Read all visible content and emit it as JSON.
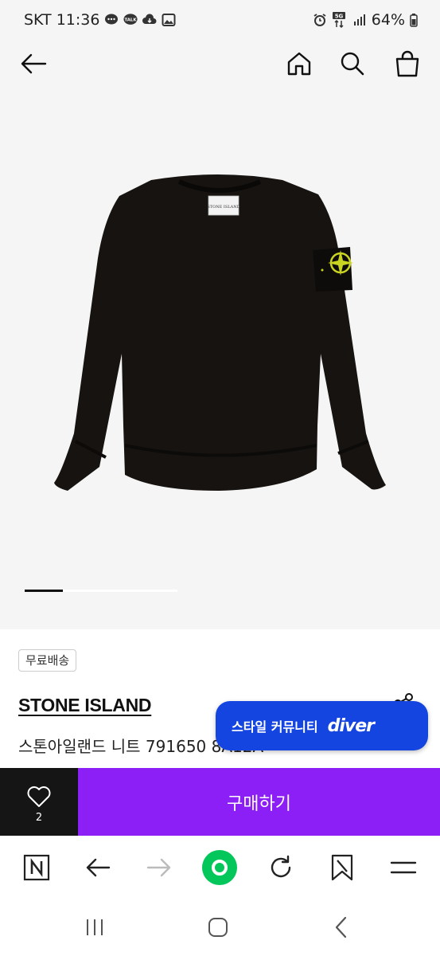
{
  "status_bar": {
    "carrier_time": "SKT 11:36",
    "talk_icon_label": "TALK",
    "network": "5G",
    "battery": "64%",
    "icons": [
      "chat-bubble-icon",
      "talk-icon",
      "cloud-download-icon",
      "gallery-icon",
      "alarm-icon",
      "network-arrows-icon",
      "signal-icon",
      "battery-icon"
    ]
  },
  "app_bar": {
    "icons": [
      "back-arrow-icon",
      "home-icon",
      "search-icon",
      "shopping-bag-icon"
    ]
  },
  "gallery": {
    "image_label": "STONE ISLAND",
    "progress": 0.25
  },
  "product": {
    "badge": "무료배송",
    "brand": "STONE ISLAND",
    "title": "스톤아일랜드 니트 791650 8A12A"
  },
  "diver_banner": {
    "text": "스타일 커뮤니티",
    "logo": "diver"
  },
  "actions": {
    "wish_count": "2",
    "buy_label": "구매하기"
  },
  "colors": {
    "buy": "#8c1ff5",
    "banner": "#1545e0",
    "naver_green": "#03c75a"
  },
  "browser_bar": {
    "icons": [
      "naver-n-icon",
      "back-arrow-icon",
      "forward-arrow-icon",
      "green-home-icon",
      "reload-icon",
      "bookmark-icon",
      "menu-icon"
    ]
  },
  "system_nav": {
    "icons": [
      "recents-icon",
      "home-icon",
      "back-icon"
    ]
  }
}
